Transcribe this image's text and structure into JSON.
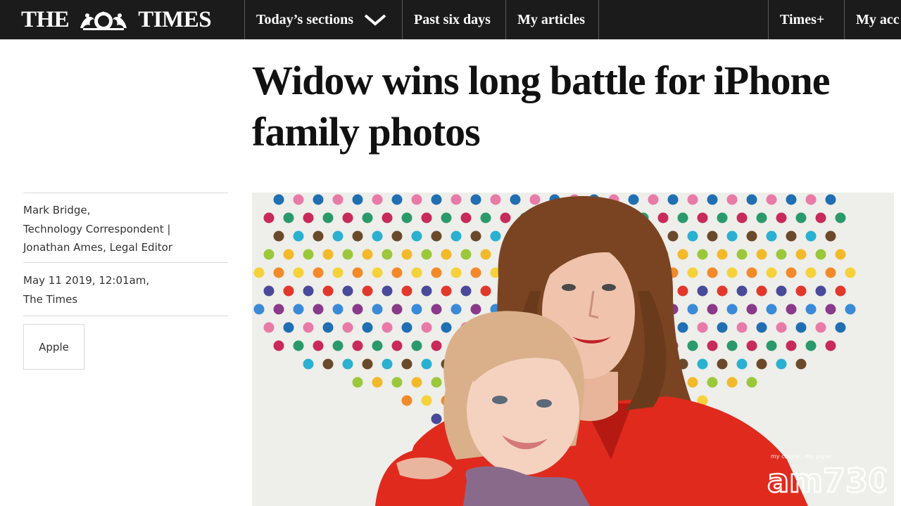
{
  "brand": {
    "name_left": "THE",
    "name_right": "TIMES"
  },
  "nav": {
    "sections_label": "Today’s sections",
    "past_days_label": "Past six days",
    "my_articles_label": "My articles",
    "times_plus_label": "Times+",
    "my_account_label": "My acc"
  },
  "article": {
    "headline": "Widow wins long battle for iPhone family photos",
    "byline": {
      "author1": "Mark Bridge,",
      "role1": "Technology Correspondent |",
      "author2": "Jonathan Ames, Legal Editor"
    },
    "date": "May 11 2019, 12:01am,",
    "publication": "The Times",
    "tag": "Apple"
  },
  "watermark": {
    "tagline": "my choice . my paper",
    "logo": "am730"
  },
  "colors": {
    "topbar": "#1b1b1b",
    "headline": "#111111",
    "dress": "#e02a1e",
    "hair": "#7a4422",
    "background": "#eeeeea"
  }
}
